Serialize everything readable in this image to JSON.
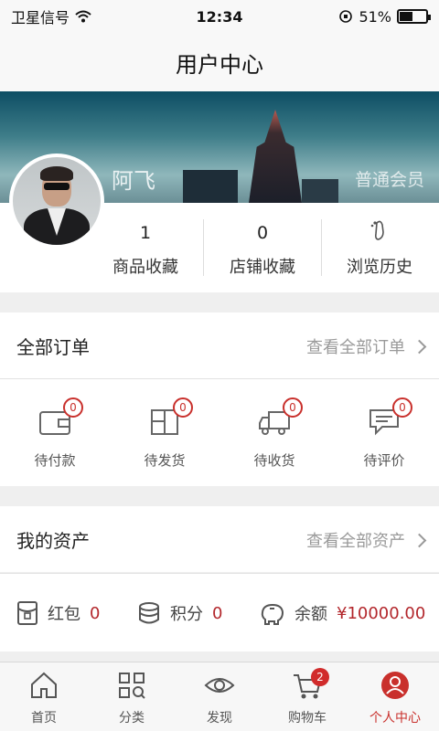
{
  "status_bar": {
    "carrier": "卫星信号",
    "time": "12:34",
    "battery": "51%",
    "battery_level": 0.51
  },
  "header": {
    "title": "用户中心"
  },
  "profile": {
    "name": "阿飞",
    "member_level": "普通会员"
  },
  "stats": [
    {
      "count": "1",
      "label": "商品收藏"
    },
    {
      "count": "0",
      "label": "店铺收藏"
    },
    {
      "label": "浏览历史",
      "icon": "footprint-icon"
    }
  ],
  "orders": {
    "title": "全部订单",
    "link": "查看全部订单",
    "items": [
      {
        "label": "待付款",
        "badge": "0",
        "icon": "wallet-icon"
      },
      {
        "label": "待发货",
        "badge": "0",
        "icon": "package-icon"
      },
      {
        "label": "待收货",
        "badge": "0",
        "icon": "truck-icon"
      },
      {
        "label": "待评价",
        "badge": "0",
        "icon": "comment-icon"
      }
    ]
  },
  "assets": {
    "title": "我的资产",
    "link": "查看全部资产",
    "items": [
      {
        "label": "红包",
        "value": "0",
        "icon": "red-packet-icon"
      },
      {
        "label": "积分",
        "value": "0",
        "icon": "coins-icon"
      },
      {
        "label": "余额",
        "value": "¥10000.00",
        "icon": "piggy-bank-icon"
      }
    ]
  },
  "tab_bar": [
    {
      "label": "首页",
      "icon": "home-icon"
    },
    {
      "label": "分类",
      "icon": "grid-search-icon"
    },
    {
      "label": "发现",
      "icon": "eye-icon"
    },
    {
      "label": "购物车",
      "icon": "cart-icon",
      "badge": "2"
    },
    {
      "label": "个人中心",
      "icon": "user-icon",
      "active": true
    }
  ],
  "colors": {
    "accent": "#c9302c",
    "banner": "#0d4e64"
  }
}
